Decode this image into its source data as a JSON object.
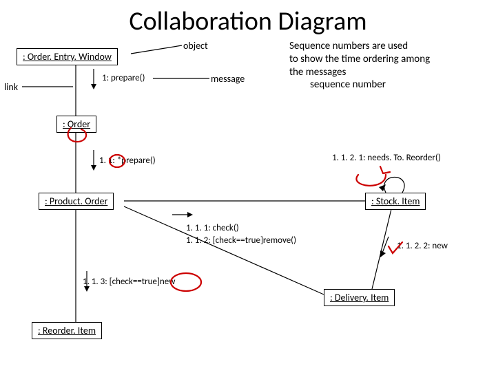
{
  "title": "Collaboration Diagram",
  "objects": {
    "orderEntryWindow": ": Order. Entry. Window",
    "order": ": Order",
    "productOrder": ": Product. Order",
    "stockItem": ": Stock. Item",
    "deliveryItem": ": Delivery. Item",
    "reorderItem": ": Reorder. Item"
  },
  "annotations": {
    "object": "object",
    "message": "message",
    "link": "link"
  },
  "messages": {
    "m1": "1: prepare()",
    "m11": "1. 1: *prepare()",
    "m111": "1. 1. 1: check()",
    "m112": "1. 1. 2: [check==true]remove()",
    "m113": "1. 1. 3: [check==true]new",
    "m1121": "1. 1. 2. 1: needs. To. Reorder()",
    "m1122": "1. 1. 2. 2: new"
  },
  "note": {
    "l1": "Sequence numbers are used",
    "l2": "to show the time ordering among",
    "l3": "the messages",
    "l4": "sequence number"
  }
}
